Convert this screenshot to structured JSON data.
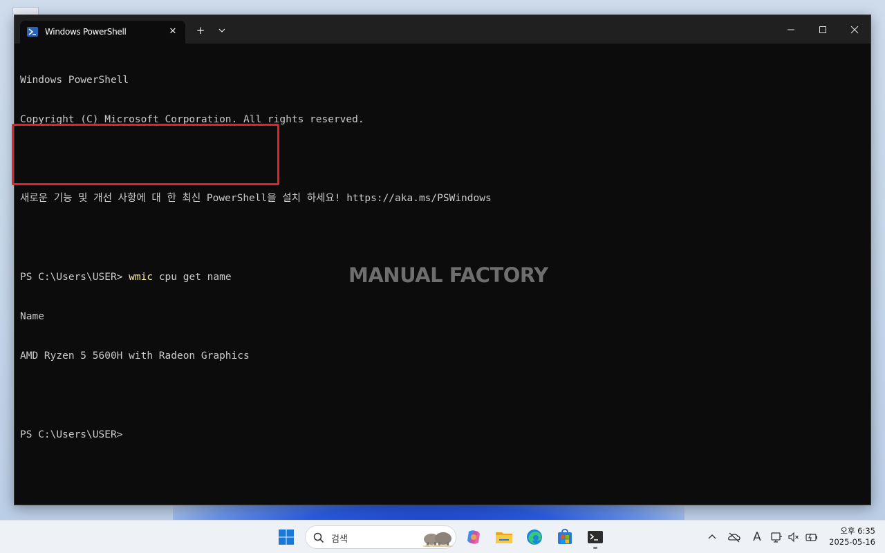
{
  "window": {
    "tab_title": "Windows PowerShell",
    "tab_icon": "powershell-icon",
    "new_tab_glyph": "+",
    "close_tab_glyph": "✕"
  },
  "console": {
    "lines": [
      {
        "text": "Windows PowerShell"
      },
      {
        "text": "Copyright (C) Microsoft Corporation. All rights reserved."
      },
      {
        "text": ""
      },
      {
        "text": "새로운 기능 및 개선 사항에 대 한 최신 PowerShell을 설치 하세요! https://aka.ms/PSWindows"
      },
      {
        "text": ""
      },
      {
        "prompt": "PS C:\\Users\\USER> ",
        "command": "wmic",
        "args": " cpu get name"
      },
      {
        "text": "Name"
      },
      {
        "text": "AMD Ryzen 5 5600H with Radeon Graphics"
      },
      {
        "text": ""
      },
      {
        "prompt": "PS C:\\Users\\USER>"
      }
    ],
    "highlight_color": "#e3222b",
    "command_color": "#f9f1a5"
  },
  "watermark": "MANUAL FACTORY",
  "taskbar": {
    "search_placeholder": "검색",
    "apps": [
      "start-icon",
      "copilot-icon",
      "file-explorer-icon",
      "edge-icon",
      "store-icon",
      "terminal-icon"
    ],
    "tray": {
      "ime_indicator": "A",
      "time": "오후 6:35",
      "date": "2025-05-16"
    }
  }
}
